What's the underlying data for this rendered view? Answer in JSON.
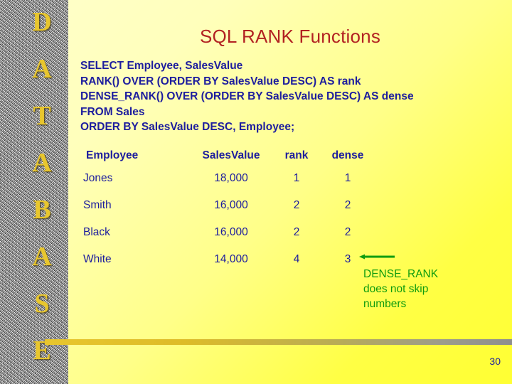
{
  "slide": {
    "title": "SQL RANK Functions",
    "page_number": "30",
    "accent_title_color": "#b22222",
    "body_text_color": "#1d1d9e",
    "annotation_color": "#0f9c0f",
    "sidebar_letter_color": "#e8c62e"
  },
  "sidebar": {
    "letters": [
      "D",
      "A",
      "T",
      "A",
      "B",
      "A",
      "S",
      "E"
    ]
  },
  "sql": {
    "lines": [
      "SELECT Employee, SalesValue",
      "RANK() OVER (ORDER BY SalesValue DESC) AS rank",
      "DENSE_RANK() OVER (ORDER BY SalesValue DESC) AS dense",
      "FROM Sales",
      "ORDER BY SalesValue DESC, Employee;"
    ]
  },
  "table": {
    "headers": [
      "Employee",
      "SalesValue",
      "rank",
      "dense"
    ],
    "rows": [
      {
        "employee": "Jones",
        "sales_value": "18,000",
        "rank": "1",
        "dense": "1"
      },
      {
        "employee": "Smith",
        "sales_value": "16,000",
        "rank": "2",
        "dense": "2"
      },
      {
        "employee": "Black",
        "sales_value": "16,000",
        "rank": "2",
        "dense": "2"
      },
      {
        "employee": "White",
        "sales_value": "14,000",
        "rank": "4",
        "dense": "3"
      }
    ]
  },
  "annotation": {
    "lines": [
      "DENSE_RANK",
      "does not skip",
      "numbers"
    ]
  }
}
